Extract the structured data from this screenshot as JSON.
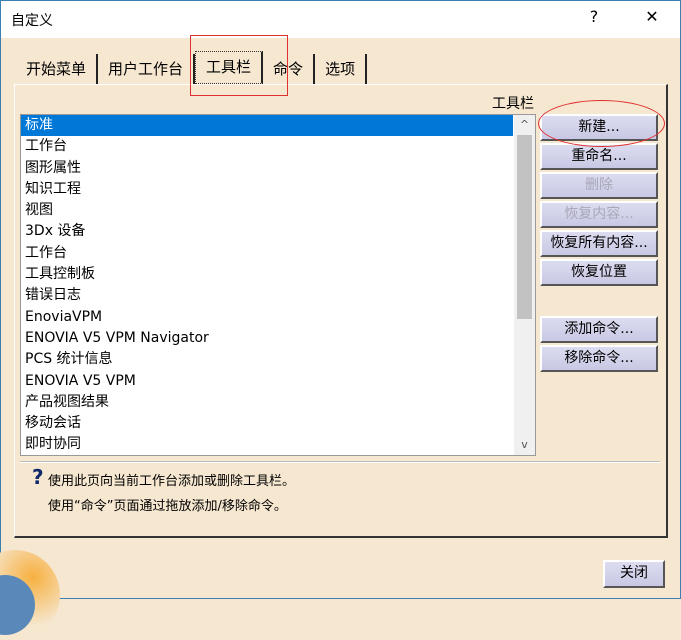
{
  "window": {
    "title": "自定义",
    "help": "?",
    "close": "✕"
  },
  "tabs": [
    {
      "label": "开始菜单"
    },
    {
      "label": "用户工作台"
    },
    {
      "label": "工具栏"
    },
    {
      "label": "命令"
    },
    {
      "label": "选项"
    }
  ],
  "list_label": "工具栏",
  "toolbars": [
    "标准",
    "工作台",
    "图形属性",
    "知识工程",
    "视图",
    "3Dx 设备",
    "工作台",
    "工具控制板",
    "错误日志",
    "EnoviaVPM",
    "ENOVIA V5 VPM Navigator",
    "PCS 统计信息",
    "ENOVIA V5 VPM",
    "产品视图结果",
    "移动会话",
    "即时协同"
  ],
  "scroll": {
    "up": "^",
    "down": "v"
  },
  "buttons": {
    "new": "新建...",
    "rename": "重命名...",
    "delete": "删除",
    "restore": "恢复内容...",
    "restore_all": "恢复所有内容...",
    "restore_pos": "恢复位置",
    "add_cmd": "添加命令...",
    "remove_cmd": "移除命令..."
  },
  "help": {
    "icon": "?",
    "line1": "使用此页向当前工作台添加或删除工具栏。",
    "line2": "使用“命令”页面通过拖放添加/移除命令。"
  },
  "close_label": "关闭"
}
